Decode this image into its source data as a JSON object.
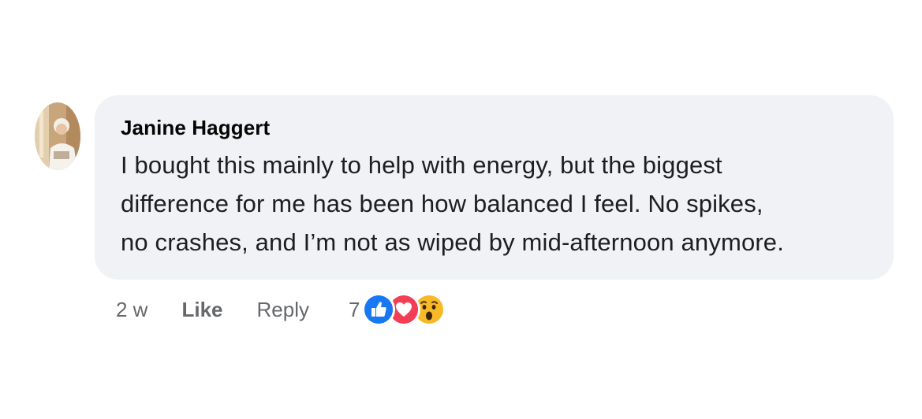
{
  "comment": {
    "author": "Janine Haggert",
    "lines": [
      "I bought this mainly to help with energy, but the biggest",
      "difference for me has been how balanced I feel. No spikes,",
      "no crashes, and I’m not as wiped by mid-afternoon anymore."
    ],
    "avatar_icon": "profile-photo",
    "timestamp": "2 w",
    "like_label": "Like",
    "reply_label": "Reply",
    "reaction_count": "7",
    "reactions": [
      "like-icon",
      "love-icon",
      "wow-icon"
    ],
    "colors": {
      "bubble": "#f0f2f5",
      "like_blue": "#1877f2",
      "love_red": "#f33e58",
      "wow_yellow": "#f7b928",
      "meta_gray": "#65676b"
    }
  }
}
